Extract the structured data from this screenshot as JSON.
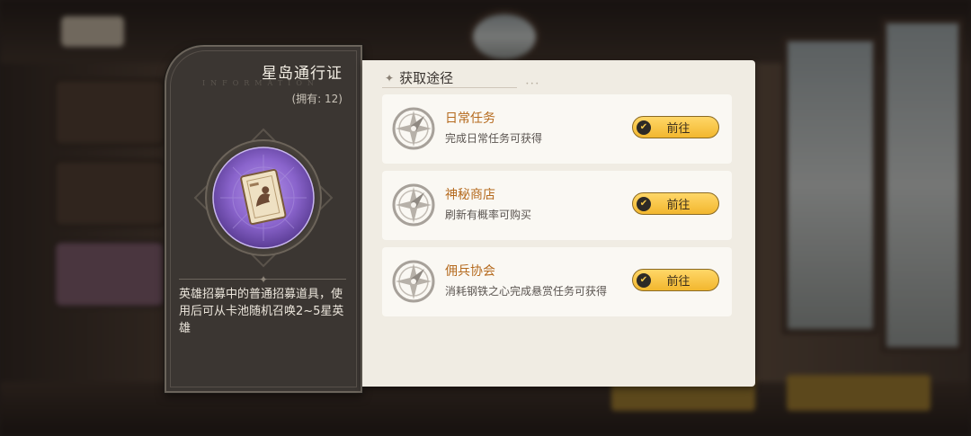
{
  "item": {
    "name": "星岛通行证",
    "watermark": "INFORMATION",
    "owned": "(拥有: 12)",
    "description": "英雄招募中的普通招募道具，使用后可从卡池随机召唤2~5星英雄",
    "icon": "recruit-scroll-icon"
  },
  "sources": {
    "title": "获取途径",
    "items": [
      {
        "name": "日常任务",
        "desc": "完成日常任务可获得",
        "button": "前往",
        "icon": "compass-icon"
      },
      {
        "name": "神秘商店",
        "desc": "刷新有概率可购买",
        "button": "前往",
        "icon": "compass-icon"
      },
      {
        "name": "佣兵协会",
        "desc": "消耗钢铁之心完成悬赏任务可获得",
        "button": "前往",
        "icon": "compass-icon"
      }
    ]
  },
  "colors": {
    "accent_orange": "#b56a1e",
    "button_gold": "#f5c84a",
    "panel_dark": "#3b3632",
    "panel_light": "#f0ece3",
    "medallion_purple": "#8e6ad0"
  }
}
